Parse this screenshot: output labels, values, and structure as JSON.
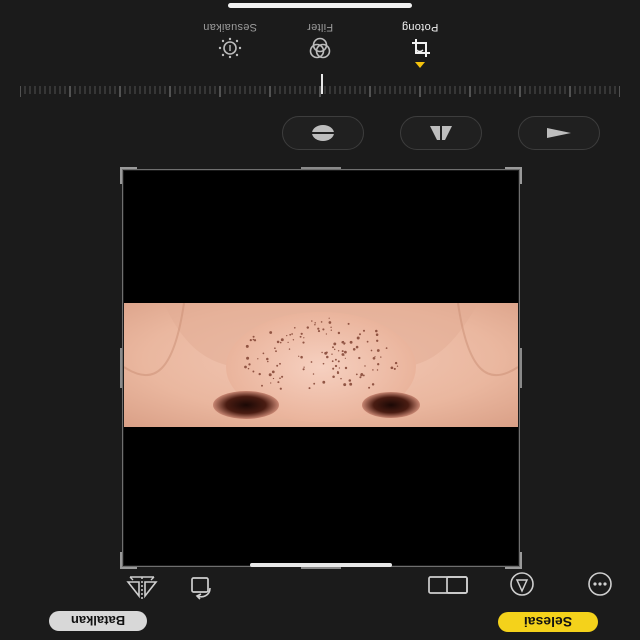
{
  "buttons": {
    "cancel_label": "Batalkan",
    "done_label": "Selesai"
  },
  "tools": [
    {
      "icon": "flip-icon"
    },
    {
      "icon": "rotate-icon"
    },
    {
      "icon": "aspect-ratio-icon"
    },
    {
      "icon": "markup-icon"
    },
    {
      "icon": "more-icon"
    }
  ],
  "straighten": [
    {
      "icon": "straighten-icon"
    },
    {
      "icon": "vertical-perspective-icon"
    },
    {
      "icon": "horizontal-perspective-icon"
    }
  ],
  "modes": [
    {
      "label": "Potong",
      "icon": "crop-icon",
      "active": true
    },
    {
      "label": "Filter",
      "icon": "filter-icon",
      "active": false
    },
    {
      "label": "Sesuaikan",
      "icon": "adjust-icon",
      "active": false
    }
  ],
  "colors": {
    "accent": "#f4d21b",
    "background": "#1b1b1b",
    "photo_letterbox": "#000000"
  }
}
